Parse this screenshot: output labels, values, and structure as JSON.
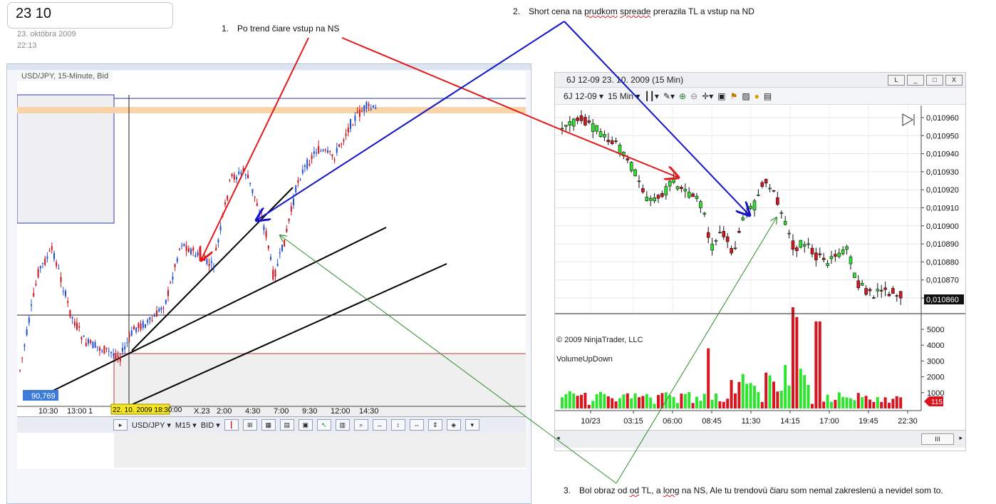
{
  "note": {
    "title": "23 10",
    "date": "23. októbra 2009",
    "time": "22:13"
  },
  "annotations": {
    "a1": {
      "num": "1.",
      "text": "Po trend čiare vstup na NS"
    },
    "a2": {
      "num": "2.",
      "pre": "Short cena na ",
      "w1": "prudkom",
      "mid": " ",
      "w2": "spreade",
      "post": " prerazila TL a vstup na ND"
    },
    "a3": {
      "num": "3.",
      "pre": "Bol  obraz od ",
      "w1": "od",
      "mid": " TL, a ",
      "w2": "long",
      "post": " na NS,    Ale tu trendovú čiaru som nemal zakreslenú a nevidel som to."
    }
  },
  "left_chart": {
    "caption": "USD/JPY, 15-Minute, Bid",
    "price_tag": "90,769",
    "date_tag": "22. 10. 2009 18:30:00",
    "x_ticks": [
      "10:30",
      "13:00",
      "1",
      "X.23",
      "2:00",
      "4:30",
      "7:00",
      "9:30",
      "12:00",
      "14:30"
    ],
    "toolbar": {
      "symbol": "USD/JPY",
      "timeframe": "M15",
      "side": "BID"
    }
  },
  "right_chart": {
    "title": "6J 12-09  23. 10. 2009 (15 Min)",
    "instrument": "6J 12-09",
    "interval": "15 Min",
    "copyright": "© 2009 NinjaTrader, LLC",
    "indicator": "VolumeUpDown",
    "last_price": "0,010860",
    "last_volume": "115",
    "price_ticks": [
      "0,010960",
      "0,010950",
      "0,010940",
      "0,010930",
      "0,010920",
      "0,010910",
      "0,010900",
      "0,010890",
      "0,010880",
      "0,010870",
      "0,010860"
    ],
    "volume_ticks": [
      "5000",
      "4000",
      "3000",
      "2000",
      "1000"
    ],
    "time_ticks": [
      "10/23",
      "03:15",
      "06:00",
      "08:45",
      "11:30",
      "14:15",
      "17:00",
      "19:45",
      "22:30"
    ],
    "window_buttons": [
      "L",
      "_",
      "□",
      "X"
    ],
    "scroll_thumb": "III"
  },
  "colors": {
    "up": "#2ee52e",
    "down": "#d8141e",
    "red_arrow": "#e01a1a",
    "blue_arrow": "#1414c8",
    "green_line": "#2e8b2e"
  }
}
